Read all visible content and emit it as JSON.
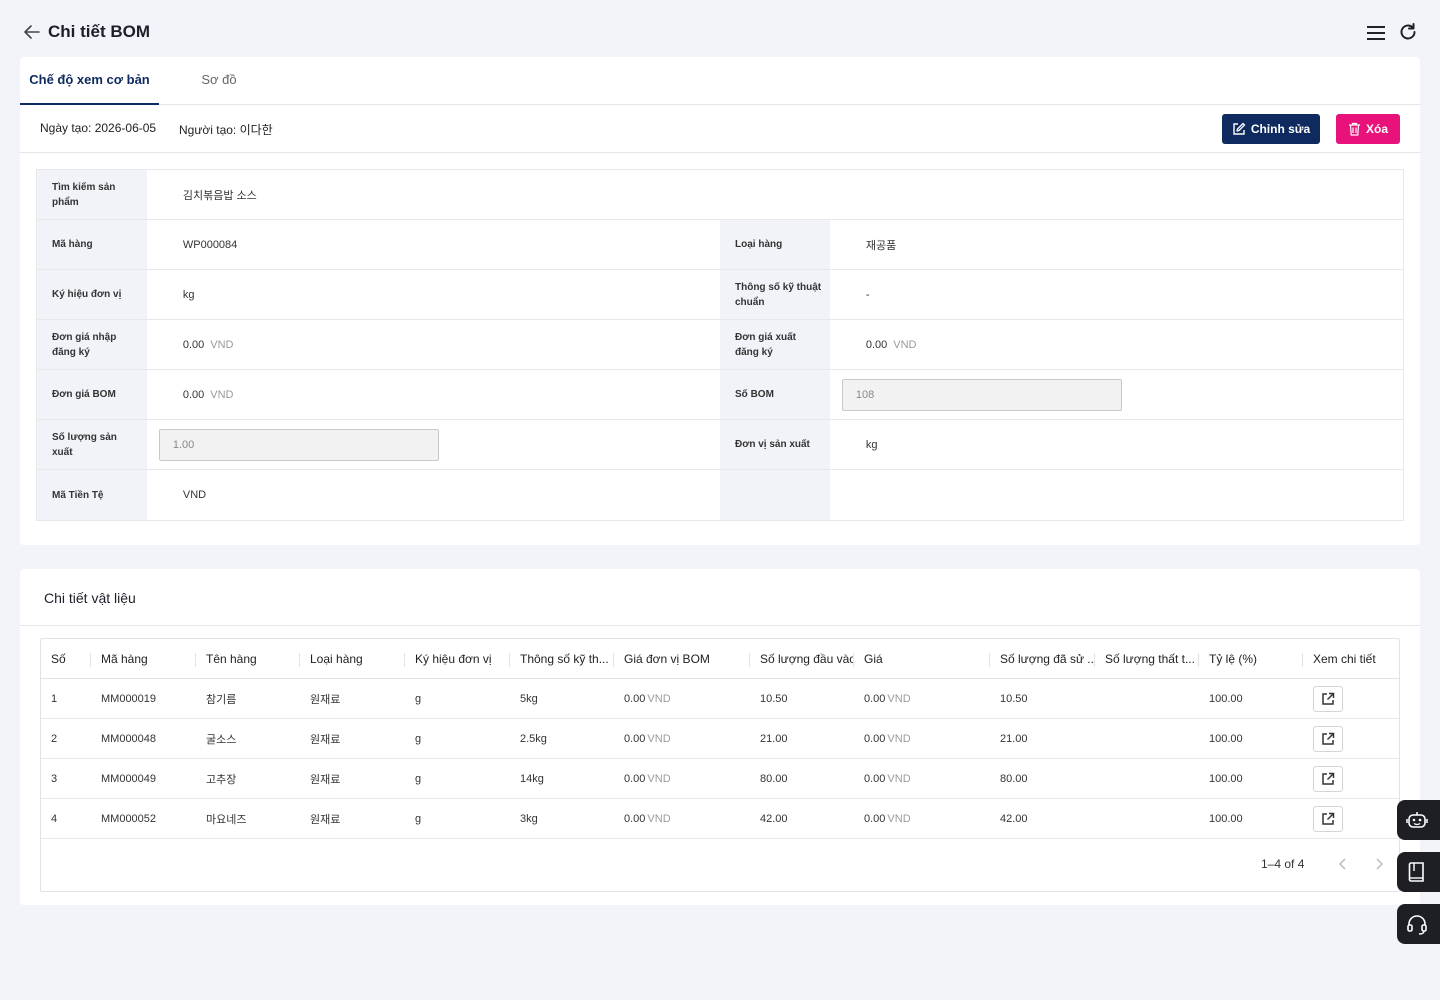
{
  "header": {
    "title": "Chi tiết BOM",
    "back_icon": "arrow-left-icon",
    "menu_icon": "hamburger-menu-icon",
    "refresh_icon": "refresh-icon"
  },
  "tabs": [
    {
      "label": "Chế độ xem cơ bản",
      "active": true
    },
    {
      "label": "Sơ đồ",
      "active": false
    }
  ],
  "meta": {
    "created": "Ngày tạo: 2026-06-05",
    "creator": "Người tạo: 이다한"
  },
  "actions": {
    "edit_label": "Chỉnh sửa",
    "delete_label": "Xóa",
    "edit_color": "#0f2a5e",
    "delete_color": "#e8127a"
  },
  "form": {
    "product_search": {
      "label": "Tìm kiếm sản phẩm",
      "value": "김치볶음밥 소스"
    },
    "item_code": {
      "label": "Mã hàng",
      "value": "WP000084"
    },
    "item_type": {
      "label": "Loại hàng",
      "value": "재공품"
    },
    "unit_symbol": {
      "label": "Ký hiệu đơn vị",
      "value": "kg"
    },
    "standard_spec": {
      "label": "Thông số kỹ thuật chuẩn",
      "value": "-"
    },
    "reg_import_price": {
      "label": "Đơn giá nhập đăng ký",
      "value": "0.00",
      "unit": "VND"
    },
    "reg_export_price": {
      "label": "Đơn giá xuất đăng ký",
      "value": "0.00",
      "unit": "VND"
    },
    "bom_price": {
      "label": "Đơn giá BOM",
      "value": "0.00",
      "unit": "VND"
    },
    "bom_number": {
      "label": "Số BOM",
      "value": "108"
    },
    "production_qty": {
      "label": "Số lượng sản xuất",
      "value": "1.00"
    },
    "production_unit": {
      "label": "Đơn vị sản xuất",
      "value": "kg"
    },
    "currency_code": {
      "label": "Mã Tiền Tệ",
      "value": "VND"
    }
  },
  "materials": {
    "title": "Chi tiết vật liệu",
    "columns": [
      "Số",
      "Mã hàng",
      "Tên hàng",
      "Loại hàng",
      "Ký hiệu đơn vị",
      "Thông số kỹ th...",
      "Giá đơn vị BOM",
      "Số lượng đầu vào",
      "Giá",
      "Số lượng đã sử ...",
      "Số lượng thất t...",
      "Tỷ lệ (%)",
      "Xem chi tiết"
    ],
    "unit": "VND",
    "rows": [
      {
        "no": "1",
        "code": "MM000019",
        "name": "참기름",
        "type": "원재료",
        "unit_symbol": "g",
        "spec": "5kg",
        "bom_price": "0.00",
        "input_qty": "10.50",
        "price": "0.00",
        "used_qty": "10.50",
        "loss_qty": "",
        "ratio": "100.00"
      },
      {
        "no": "2",
        "code": "MM000048",
        "name": "굴소스",
        "type": "원재료",
        "unit_symbol": "g",
        "spec": "2.5kg",
        "bom_price": "0.00",
        "input_qty": "21.00",
        "price": "0.00",
        "used_qty": "21.00",
        "loss_qty": "",
        "ratio": "100.00"
      },
      {
        "no": "3",
        "code": "MM000049",
        "name": "고추장",
        "type": "원재료",
        "unit_symbol": "g",
        "spec": "14kg",
        "bom_price": "0.00",
        "input_qty": "80.00",
        "price": "0.00",
        "used_qty": "80.00",
        "loss_qty": "",
        "ratio": "100.00"
      },
      {
        "no": "4",
        "code": "MM000052",
        "name": "마요네즈",
        "type": "원재료",
        "unit_symbol": "g",
        "spec": "3kg",
        "bom_price": "0.00",
        "input_qty": "42.00",
        "price": "0.00",
        "used_qty": "42.00",
        "loss_qty": "",
        "ratio": "100.00"
      }
    ],
    "pagination": "1–4 of 4"
  },
  "floating": [
    "robot-assistant-icon",
    "book-icon",
    "headset-support-icon"
  ]
}
